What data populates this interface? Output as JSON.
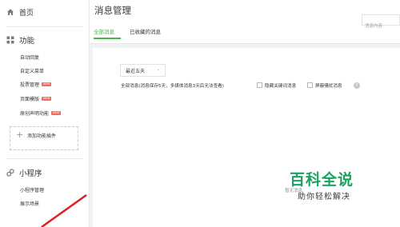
{
  "sidebar": {
    "home": {
      "label": "首页",
      "icon": "home-icon"
    },
    "features": {
      "label": "功能",
      "icon": "grid-icon",
      "items": [
        {
          "label": "自动回复",
          "badge": ""
        },
        {
          "label": "自定义菜单",
          "badge": ""
        },
        {
          "label": "投票管理",
          "badge": "NEW"
        },
        {
          "label": "页面模版",
          "badge": "NEW"
        },
        {
          "label": "原创声明功能",
          "badge": "NEW"
        }
      ],
      "add_plugin": "添加功能插件"
    },
    "mini_program": {
      "label": "小程序",
      "icon": "link-icon",
      "items": [
        {
          "label": "小程序管理"
        },
        {
          "label": "展示场景"
        }
      ]
    }
  },
  "header": {
    "title": "消息管理",
    "search_placeholder": "消息内容",
    "tabs": [
      {
        "label": "全部消息",
        "active": true
      },
      {
        "label": "已收藏的消息",
        "active": false
      }
    ]
  },
  "main": {
    "range_select": {
      "value": "最近五天"
    },
    "filter_text": "全部消息(消息保存5天，多媒体消息3天后无法查看)",
    "checkboxes": [
      {
        "label": "隐藏关键词消息",
        "checked": false
      },
      {
        "label": "屏蔽骚扰消息",
        "checked": false
      }
    ],
    "empty_text": "暂无消息"
  },
  "watermark": {
    "title": "百科全说",
    "subtitle": "助你轻松解决"
  },
  "colors": {
    "accent": "#44b549",
    "badge": "#f46a5c",
    "arrow": "#e02020",
    "watermark": "#1aa260"
  }
}
